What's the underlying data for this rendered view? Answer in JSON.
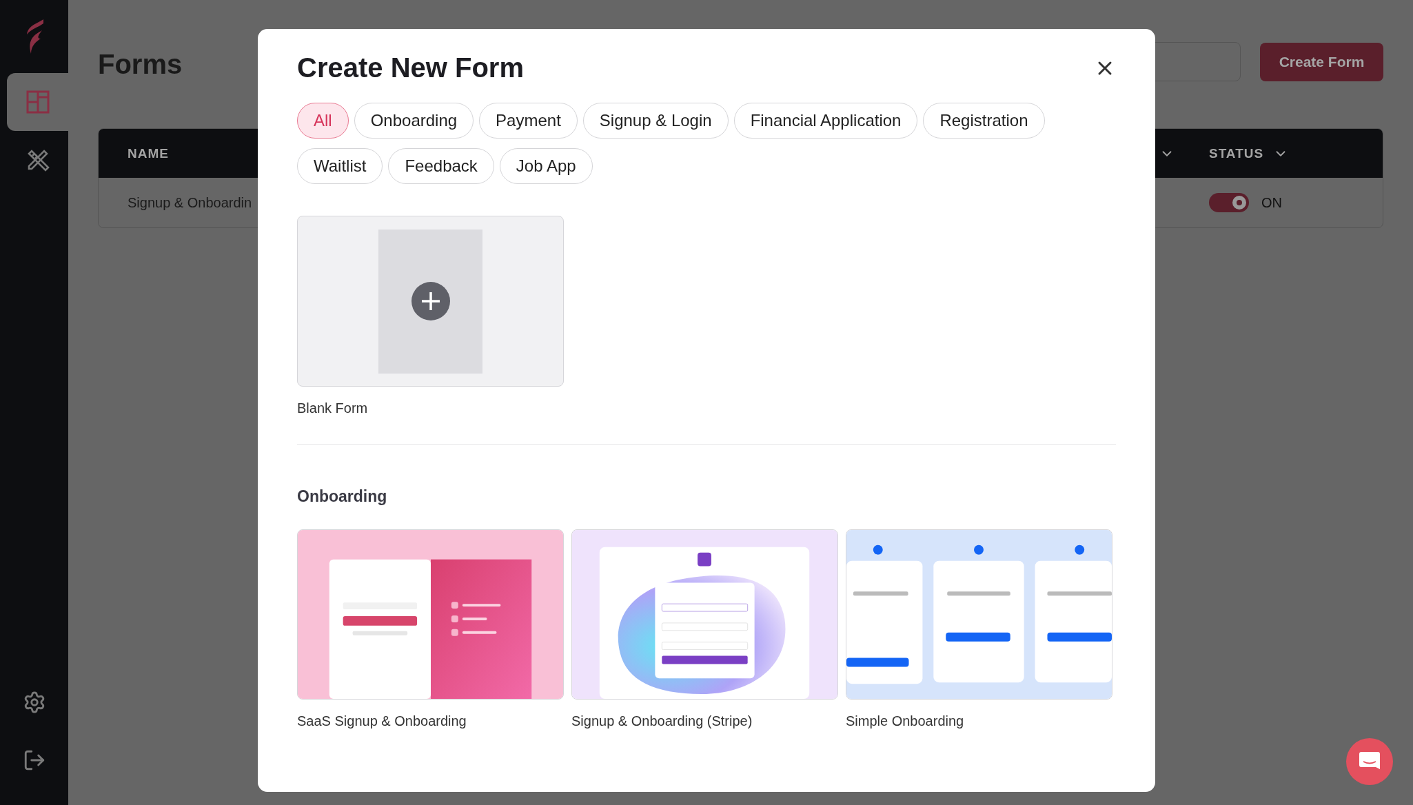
{
  "sidebar": {
    "items": [
      {
        "selected": true
      },
      {
        "selected": false
      }
    ]
  },
  "page": {
    "title": "Forms",
    "create_button": "Create Form",
    "table": {
      "columns": [
        {
          "label": "NAME"
        },
        {
          "label": "STATUS"
        }
      ],
      "rows": [
        {
          "name": "Signup & Onboardin",
          "status": {
            "on": true,
            "label": "ON"
          }
        }
      ]
    }
  },
  "modal": {
    "title": "Create New Form",
    "filters": [
      {
        "label": "All",
        "selected": true
      },
      {
        "label": "Onboarding",
        "selected": false
      },
      {
        "label": "Payment",
        "selected": false
      },
      {
        "label": "Signup & Login",
        "selected": false
      },
      {
        "label": "Financial Application",
        "selected": false
      },
      {
        "label": "Registration",
        "selected": false
      },
      {
        "label": "Waitlist",
        "selected": false
      },
      {
        "label": "Feedback",
        "selected": false
      },
      {
        "label": "Job App",
        "selected": false
      }
    ],
    "blank": {
      "label": "Blank Form"
    },
    "sections": [
      {
        "heading": "Onboarding",
        "templates": [
          {
            "label": "SaaS Signup & Onboarding"
          },
          {
            "label": "Signup & Onboarding (Stripe)"
          },
          {
            "label": "Simple Onboarding"
          }
        ]
      }
    ]
  }
}
